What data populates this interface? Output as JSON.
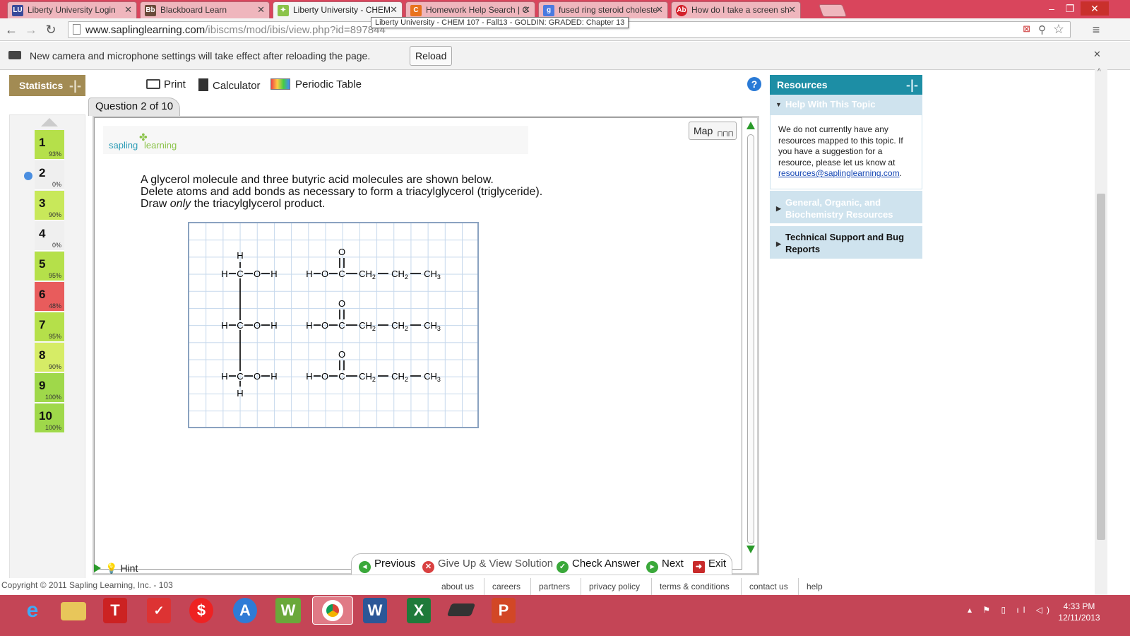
{
  "browser": {
    "tabs": [
      {
        "label": "Liberty University Login",
        "favicon": "LU",
        "color": "#3a4a9a"
      },
      {
        "label": "Blackboard Learn",
        "favicon": "Bb",
        "color": "#6a4a3a"
      },
      {
        "label": "Liberty University - CHEM",
        "favicon": "✦",
        "color": "#8bc34a"
      },
      {
        "label": "Homework Help Search | C",
        "favicon": "C",
        "color": "#e8731d"
      },
      {
        "label": "fused ring steroid choleste",
        "favicon": "g",
        "color": "#4a7ae0"
      },
      {
        "label": "How do I take a screen sh",
        "favicon": "Ab",
        "color": "#d3202a"
      }
    ],
    "url_main": "www.saplinglearning.com",
    "url_path": "/ibiscms/mod/ibis/view.php?id=",
    "url_hidden": "897844",
    "tooltip": "Liberty University - CHEM 107 - Fall13 - GOLDIN: GRADED: Chapter 13",
    "infobar_text": "New camera and microphone settings will take effect after reloading the page.",
    "reload_label": "Reload"
  },
  "stats": {
    "title": "Statistics",
    "questions": [
      {
        "n": "1",
        "pct": "93%",
        "color": "#b5e04a"
      },
      {
        "n": "2",
        "pct": "0%",
        "color": "#efefef"
      },
      {
        "n": "3",
        "pct": "90%",
        "color": "#c8e85a"
      },
      {
        "n": "4",
        "pct": "0%",
        "color": "#efefef"
      },
      {
        "n": "5",
        "pct": "95%",
        "color": "#b5e04a"
      },
      {
        "n": "6",
        "pct": "48%",
        "color": "#e85c5c"
      },
      {
        "n": "7",
        "pct": "95%",
        "color": "#b5e04a"
      },
      {
        "n": "8",
        "pct": "90%",
        "color": "#d6ec66"
      },
      {
        "n": "9",
        "pct": "100%",
        "color": "#9fd84a"
      },
      {
        "n": "10",
        "pct": "100%",
        "color": "#9fd84a"
      }
    ]
  },
  "tools": {
    "print": "Print",
    "calculator": "Calculator",
    "periodic": "Periodic Table"
  },
  "question": {
    "tab": "Question 2 of 10",
    "logo_a": "sapling",
    "logo_b": "learning",
    "map_label": "Map",
    "line1": "A glycerol molecule and three butyric acid molecules are shown below.",
    "line2": "Delete atoms and add bonds as necessary to form a triacylglycerol (triglyceride).",
    "line3_a": "Draw ",
    "line3_em": "only",
    "line3_b": " the triacylglycerol product."
  },
  "molecule": {
    "H": "H",
    "C": "C",
    "O": "O",
    "CH2": "CH",
    "CH3": "CH",
    "sub2": "2",
    "sub3": "3"
  },
  "nav": {
    "hint": "Hint",
    "previous": "Previous",
    "giveup": "Give Up & View Solution",
    "check": "Check Answer",
    "next": "Next",
    "exit": "Exit"
  },
  "resources": {
    "title": "Resources",
    "help_topic": "Help With This Topic",
    "body": "We do not currently have any resources mapped to this topic. If you have a suggestion for a resource, please let us know at",
    "email": "resources@saplinglearning.com",
    "section2": "General, Organic, and Biochemistry Resources",
    "section3": "Technical Support and Bug Reports"
  },
  "footer": {
    "copyright": "Copyright © 2011 Sapling Learning, Inc. - 103",
    "links": [
      "about us",
      "careers",
      "partners",
      "privacy policy",
      "terms & conditions",
      "contact us",
      "help"
    ]
  },
  "taskbar": {
    "time": "4:33 PM",
    "date": "12/11/2013"
  }
}
